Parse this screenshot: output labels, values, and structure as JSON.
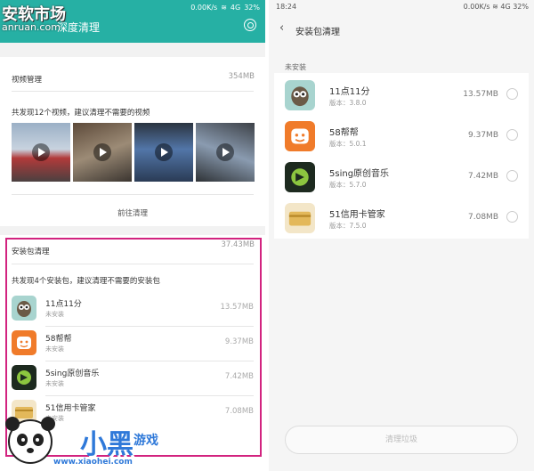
{
  "watermark": {
    "brand_top": "安软市场",
    "url_top": "anruan.com",
    "brand_bottom": "小黑",
    "brand_bottom_sub": "游戏",
    "url_bottom": "www.xiaohei.com"
  },
  "left": {
    "status": {
      "speed": "0.00K/s",
      "signal": "4G",
      "battery": "32%"
    },
    "header": {
      "title": "深度清理"
    },
    "video_card": {
      "title": "视频管理",
      "size": "354MB",
      "desc": "共发现12个视频，建议清理不需要的视频",
      "action": "前往清理"
    },
    "package_card": {
      "title": "安装包清理",
      "size": "37.43MB",
      "desc": "共发现4个安装包，建议清理不需要的安装包",
      "apps": [
        {
          "name": "11点11分",
          "status": "未安装",
          "size": "13.57MB",
          "icon": "owl-icon"
        },
        {
          "name": "58帮帮",
          "status": "未安装",
          "size": "9.37MB",
          "icon": "58-icon"
        },
        {
          "name": "5sing原创音乐",
          "status": "未安装",
          "size": "7.42MB",
          "icon": "5sing-icon"
        },
        {
          "name": "51信用卡管家",
          "status": "未安装",
          "size": "7.08MB",
          "icon": "card-icon"
        }
      ]
    }
  },
  "right": {
    "status": {
      "time": "18:24",
      "speed": "0.00K/s",
      "signal": "4G",
      "battery": "32%"
    },
    "header": {
      "back": "‹",
      "title": "安装包清理"
    },
    "section": "未安装",
    "apps": [
      {
        "name": "11点11分",
        "version": "版本：3.8.0",
        "size": "13.57MB",
        "icon": "owl-icon"
      },
      {
        "name": "58帮帮",
        "version": "版本：5.0.1",
        "size": "9.37MB",
        "icon": "58-icon"
      },
      {
        "name": "5sing原创音乐",
        "version": "版本：5.7.0",
        "size": "7.42MB",
        "icon": "5sing-icon"
      },
      {
        "name": "51信用卡管家",
        "version": "版本：7.5.0",
        "size": "7.08MB",
        "icon": "card-icon"
      }
    ],
    "clean_button": "清理垃圾"
  },
  "colors": {
    "header": "#26b0a4",
    "highlight": "#d2237f",
    "watermark": "#2f79d9"
  }
}
